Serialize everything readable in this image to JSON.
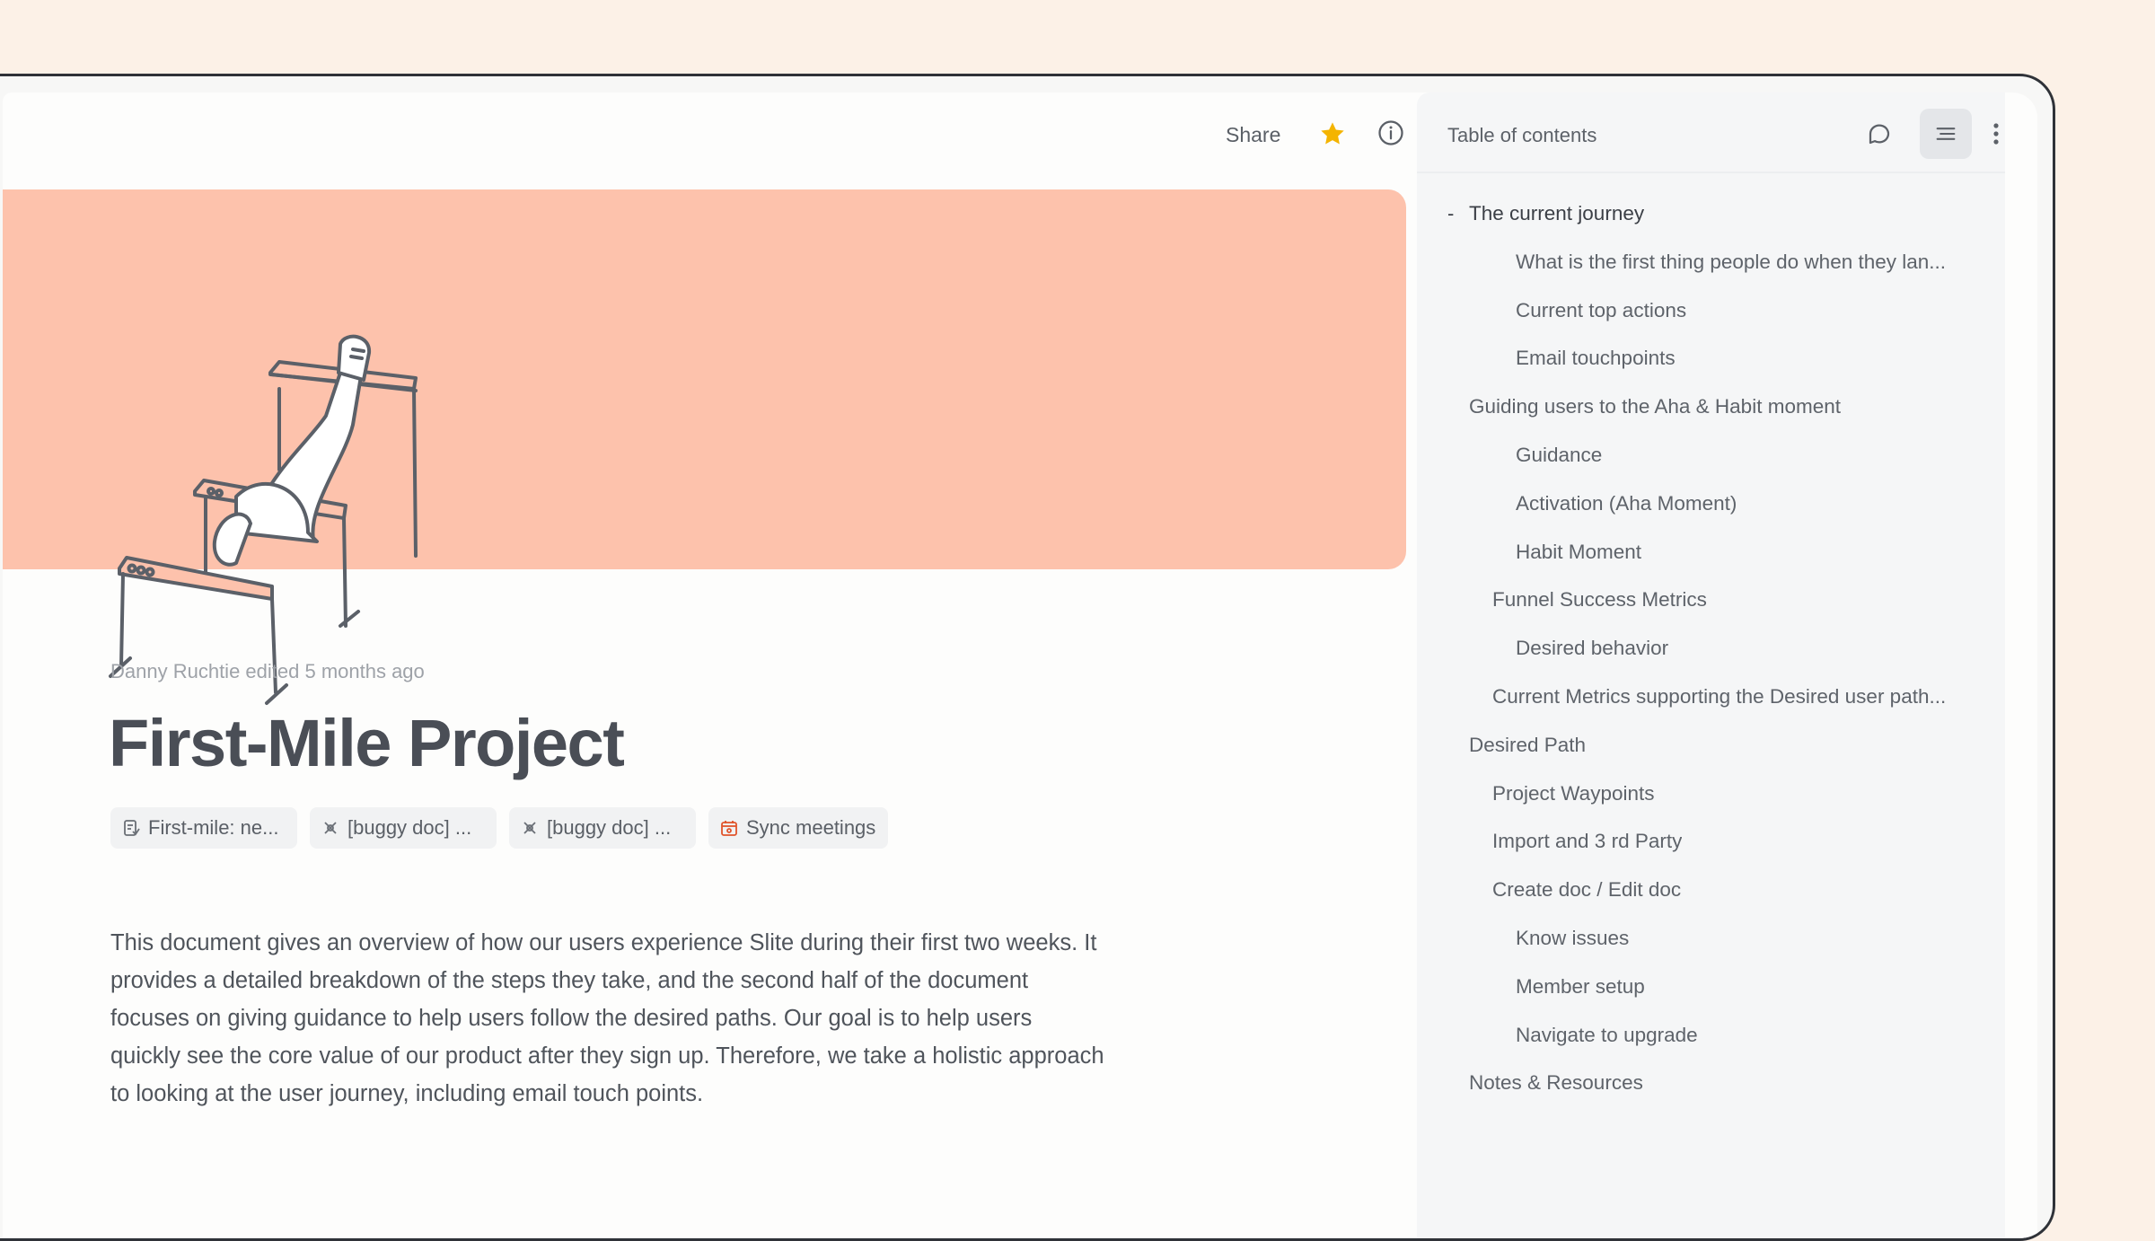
{
  "toolbar": {
    "share_label": "Share",
    "star_icon": "star-icon",
    "star_color": "#f4b400",
    "info_icon": "info-icon"
  },
  "banner": {
    "color": "#fdc2ac",
    "illustration": "hurdles-illustration"
  },
  "document": {
    "meta": "Danny Ruchtie edited 5 months ago",
    "title": "First-Mile Project",
    "chips": [
      {
        "icon": "doc-icon",
        "label": "First-mile: ne..."
      },
      {
        "icon": "bug-icon",
        "label": "[buggy doc] ..."
      },
      {
        "icon": "bug-icon",
        "label": "[buggy doc] ..."
      },
      {
        "icon": "calendar-icon",
        "label": "Sync meetings"
      }
    ],
    "body": "This document gives an overview of how our users experience Slite during their first two weeks. It provides a detailed breakdown of the steps they take, and the second half of the document focuses on giving guidance to help users follow the desired paths. Our goal is to help users quickly see the core value of our product after they sign up. Therefore, we take a holistic approach to looking at the user journey, including email touch points."
  },
  "sidebar": {
    "title": "Table of contents",
    "collapse_marker": "-",
    "items": [
      {
        "label": "The current journey",
        "level": 0
      },
      {
        "label": "What is the first thing people do when they lan...",
        "level": 3
      },
      {
        "label": "Current top actions",
        "level": 3
      },
      {
        "label": "Email touchpoints",
        "level": 3
      },
      {
        "label": "Guiding users to the Aha & Habit moment",
        "level": 1
      },
      {
        "label": "Guidance",
        "level": 3
      },
      {
        "label": "Activation (Aha Moment)",
        "level": 3
      },
      {
        "label": "Habit Moment",
        "level": 3
      },
      {
        "label": "Funnel Success Metrics",
        "level": 2
      },
      {
        "label": "Desired behavior",
        "level": 3
      },
      {
        "label": "Current Metrics supporting the Desired user path...",
        "level": 2
      },
      {
        "label": "Desired Path",
        "level": 1
      },
      {
        "label": "Project Waypoints",
        "level": 2
      },
      {
        "label": "Import and 3 rd Party",
        "level": 2
      },
      {
        "label": "Create doc / Edit doc",
        "level": 2
      },
      {
        "label": "Know issues",
        "level": 3
      },
      {
        "label": "Member setup",
        "level": 3
      },
      {
        "label": "Navigate to upgrade",
        "level": 3
      },
      {
        "label": "Notes & Resources",
        "level": 1
      }
    ]
  }
}
